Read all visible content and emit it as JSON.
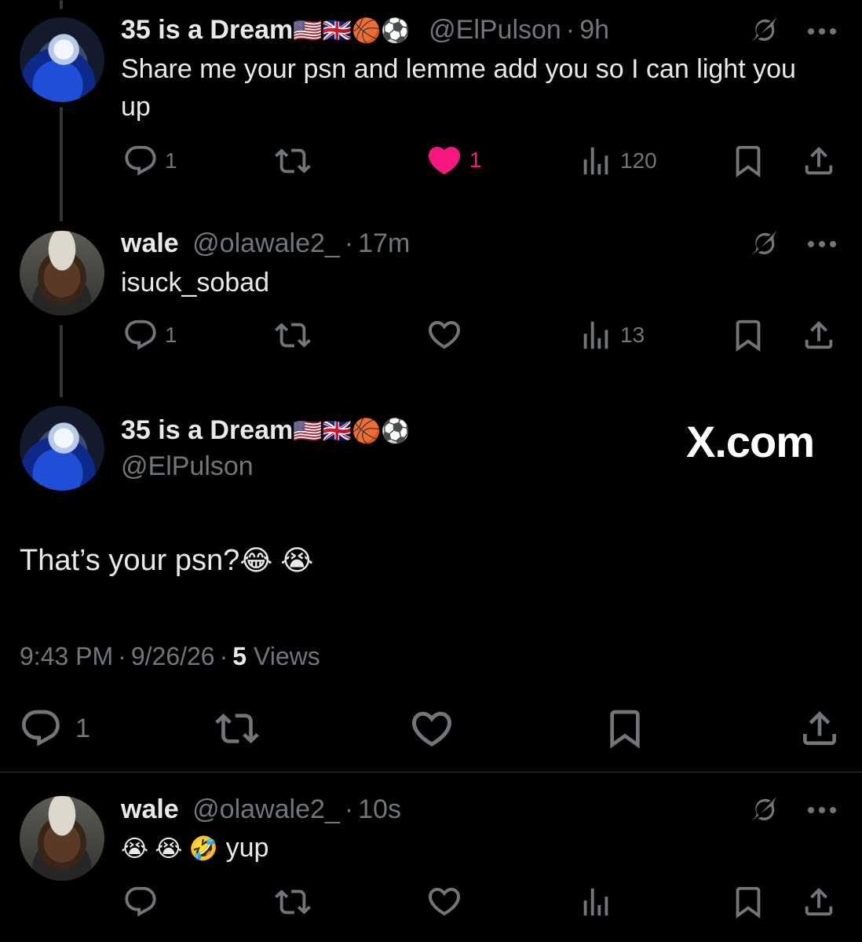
{
  "colors": {
    "background": "#000000",
    "text_primary": "#e7e9ea",
    "text_secondary": "#71767b",
    "like_active": "#f91880",
    "divider": "#2f3336"
  },
  "reply1": {
    "display_name": "35 is a Dream",
    "name_emojis": "🇺🇸🇬🇧🏀⚽",
    "handle": "@ElPulson",
    "separator": "·",
    "time": "9h",
    "text": "Share me your psn and lemme add you so I can light you up",
    "actions": {
      "replies": "1",
      "retweets": "",
      "likes": "1",
      "views": "120"
    },
    "liked": true
  },
  "reply2": {
    "display_name": "wale",
    "handle": "@olawale2_",
    "separator": "·",
    "time": "17m",
    "text": "isuck_sobad",
    "actions": {
      "replies": "1",
      "retweets": "",
      "likes": "",
      "views": "13"
    },
    "liked": false
  },
  "focus_tweet": {
    "display_name": "35 is a Dream",
    "name_emojis": "🇺🇸🇬🇧🏀⚽",
    "handle": "@ElPulson",
    "text": "That’s your psn?",
    "text_emojis": "😂 😭",
    "time": "9:43 PM",
    "separator": "·",
    "date": "9/26/26",
    "views_count": "5",
    "views_label": "Views",
    "actions": {
      "replies": "1"
    },
    "watermark": "X.com"
  },
  "reply3": {
    "display_name": "wale",
    "handle": "@olawale2_",
    "separator": "·",
    "time": "10s",
    "text_emojis": "😭 😭 🤣",
    "text": "yup"
  },
  "icons": {
    "reply": "reply-icon",
    "retweet": "retweet-icon",
    "like": "heart-icon",
    "views": "views-icon",
    "bookmark": "bookmark-icon",
    "share": "share-icon",
    "grok": "grok-icon",
    "more": "more-icon"
  }
}
